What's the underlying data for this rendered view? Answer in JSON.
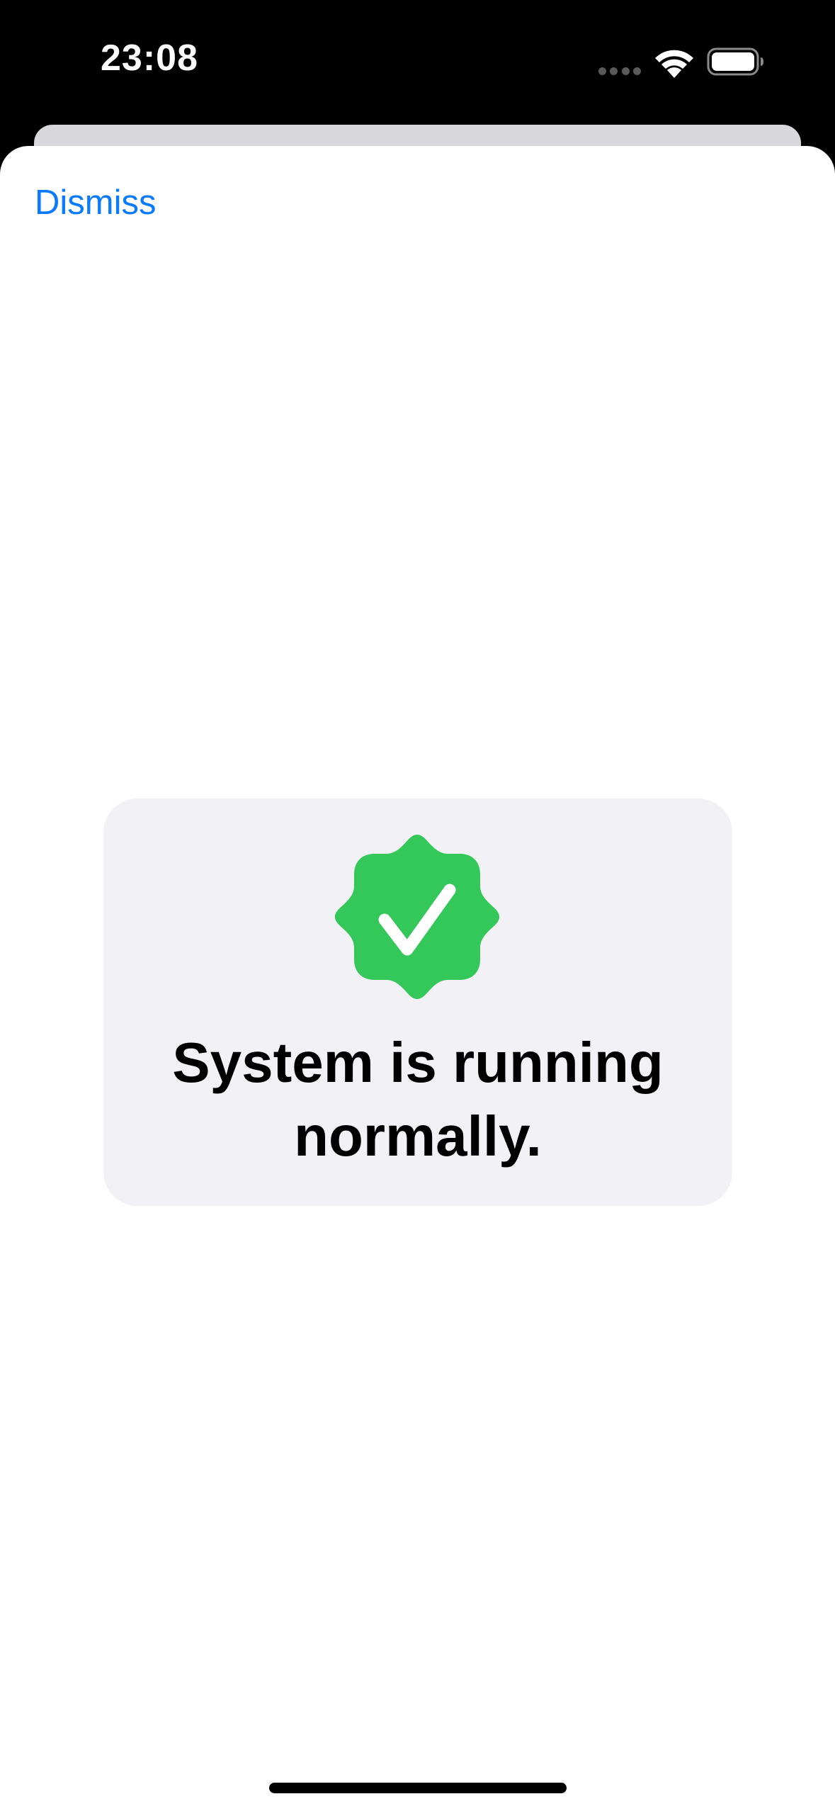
{
  "status_bar": {
    "time": "23:08"
  },
  "sheet": {
    "dismiss_label": "Dismiss"
  },
  "status_card": {
    "icon": "checkmark-seal-icon",
    "message": "System is running normally.",
    "icon_color": "#34c759"
  },
  "colors": {
    "accent": "#0a7aff",
    "card_background": "#f2f2f6",
    "success": "#34c759"
  }
}
